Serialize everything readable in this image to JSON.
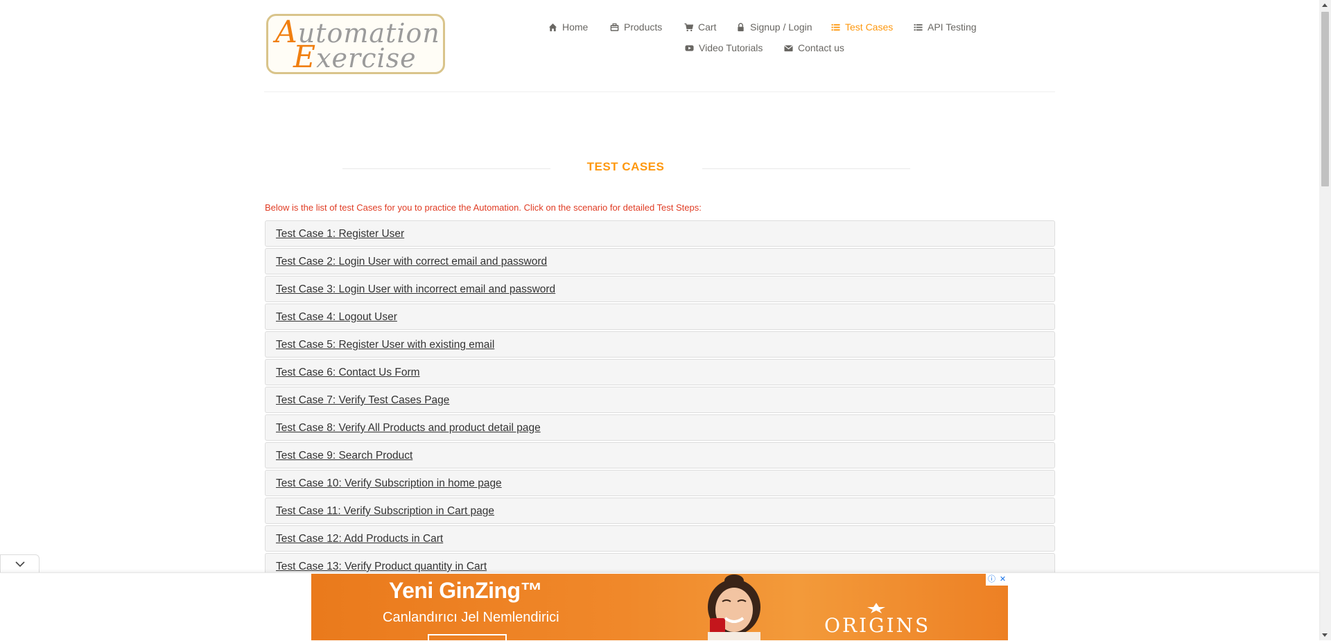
{
  "logo": {
    "line1_cap": "A",
    "line1_rest": "utomation",
    "line2_cap": "E",
    "line2_rest": "xercise"
  },
  "nav": {
    "home": "Home",
    "products": "Products",
    "cart": "Cart",
    "login": "Signup / Login",
    "test_cases": "Test Cases",
    "api_testing": "API Testing",
    "video_tutorials": "Video Tutorials",
    "contact": "Contact us"
  },
  "page": {
    "title": "TEST CASES",
    "intro": "Below is the list of test Cases for you to practice the Automation. Click on the scenario for detailed Test Steps:"
  },
  "test_cases": [
    "Test Case 1: Register User",
    "Test Case 2: Login User with correct email and password",
    "Test Case 3: Login User with incorrect email and password",
    "Test Case 4: Logout User",
    "Test Case 5: Register User with existing email",
    "Test Case 6: Contact Us Form",
    "Test Case 7: Verify Test Cases Page",
    "Test Case 8: Verify All Products and product detail page",
    "Test Case 9: Search Product",
    "Test Case 10: Verify Subscription in home page",
    "Test Case 11: Verify Subscription in Cart page",
    "Test Case 12: Add Products in Cart",
    "Test Case 13: Verify Product quantity in Cart"
  ],
  "ad": {
    "headline": "Yeni GinZing™",
    "subline": "Canlandırıcı Jel Nemlendirici",
    "brand": "ORIGINS",
    "info_icon": "info-icon",
    "close_icon": "close-icon"
  },
  "colors": {
    "accent": "#fe980f",
    "intro_text": "#e03c24",
    "ad_orange": "#ea7a1c"
  }
}
